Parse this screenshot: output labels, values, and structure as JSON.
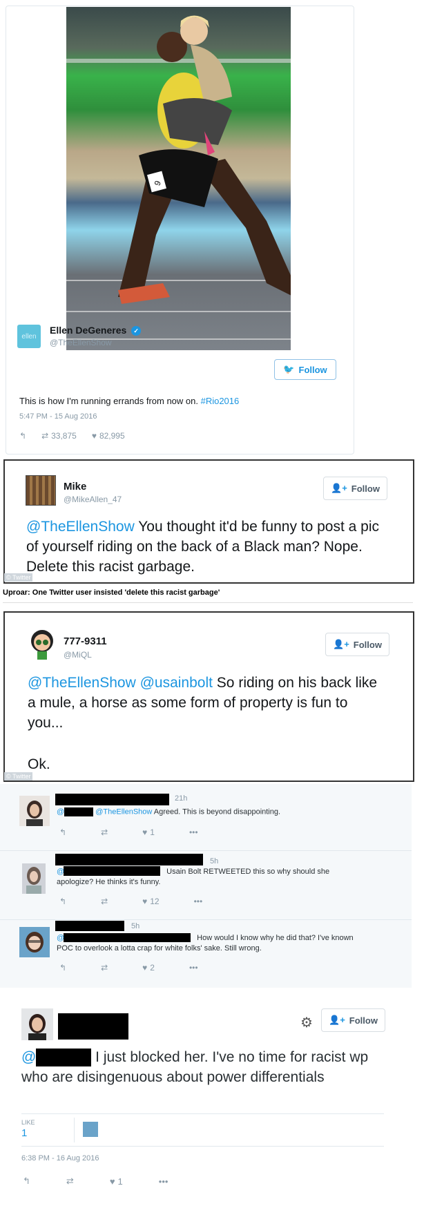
{
  "tweet1": {
    "name": "Ellen DeGeneres",
    "handle": "@TheEllenShow",
    "avatar_text": "ellen",
    "follow": "Follow",
    "text": "This is how I'm running errands from now on. ",
    "hashtag": "#Rio2016",
    "time": "5:47 PM - 15 Aug 2016",
    "retweets": "33,875",
    "likes": "82,995",
    "bib": "9"
  },
  "tweet2": {
    "name": "Mike",
    "handle": "@MikeAllen_47",
    "follow": "Follow",
    "mention": "@TheEllenShow",
    "text": " You thought it'd be funny to post a pic of yourself riding on the back of a Black man? Nope. Delete this racist garbage.",
    "watermark": "© Twitter"
  },
  "caption": "Uproar: One Twitter user insisted 'delete this racist garbage'",
  "tweet3": {
    "name": "777-9311",
    "handle": "@MiQL",
    "follow": "Follow",
    "mention1": "@TheEllenShow",
    "mention2": "@usainbolt",
    "text": " So riding on his back like a mule, a horse as some form of property is fun to you...",
    "text2": "Ok.",
    "watermark": "© Twitter"
  },
  "replies": [
    {
      "time": "21h",
      "at": "@",
      "mention": "@TheEllenShow",
      "text": " Agreed. This is beyond disappointing.",
      "likes": "1"
    },
    {
      "time": "5h",
      "at": "@",
      "text": "Usain Bolt RETWEETED this so why should she",
      "text2": "apologize? He thinks it's funny.",
      "likes": "12"
    },
    {
      "time": "5h",
      "at": "@",
      "text": "How would I know why he did that? I've known",
      "text2": "POC to overlook a lotta crap for white folks' sake. Still wrong.",
      "likes": "2"
    }
  ],
  "tweet4": {
    "follow": "Follow",
    "at": "@",
    "text": " I just blocked her. I've no time for racist wp who are disingenuous about power differentials",
    "like_label": "LIKE",
    "like_count": "1",
    "time": "6:38 PM - 16 Aug 2016",
    "likes": "1"
  },
  "colors": {
    "link": "#1b95e0",
    "muted": "#8899a6",
    "ellen_avatar": "#5fc3dd"
  }
}
